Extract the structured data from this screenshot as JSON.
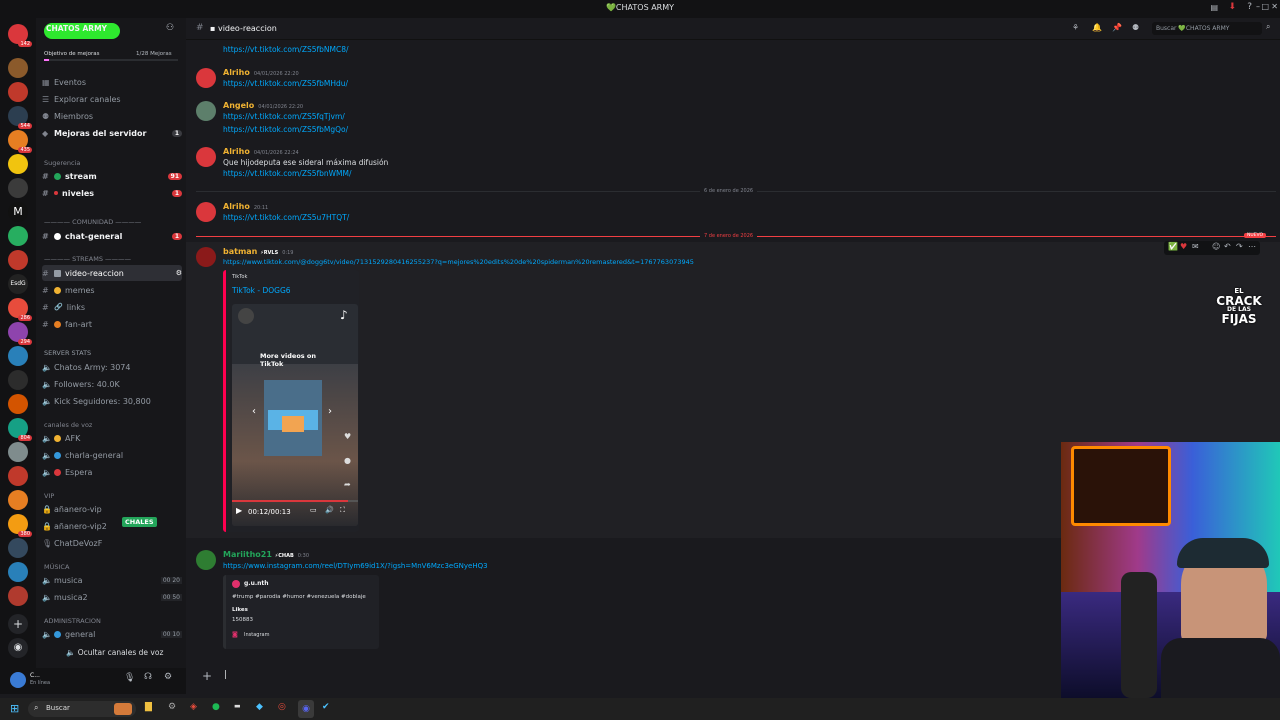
{
  "titlebar": {
    "title": "💚CHATOS ARMY"
  },
  "server": {
    "name": "CHATOS ARMY",
    "boost_label": "Objetivo de mejoras",
    "boost_count": "1/28 Mejoras"
  },
  "server_badges": [
    "142",
    "",
    "",
    "",
    "544",
    "435",
    "",
    "",
    "",
    "",
    "",
    "",
    "",
    "",
    "286",
    "",
    "294",
    "",
    "",
    "804",
    "",
    "",
    "380",
    "",
    "",
    ""
  ],
  "nav": {
    "events": "Eventos",
    "browse": "Explorar canales",
    "members": "Miembros",
    "boosts": "Mejoras del servidor",
    "boosts_badge": "1"
  },
  "channels": {
    "cat_suggestion": "Sugerencia",
    "stream": "stream",
    "stream_badge": "91",
    "niveles": "niveles",
    "niveles_badge": "1",
    "cat_comunidad": "———— COMUNIDAD ————",
    "chat_general": "chat-general",
    "chat_general_badge": "1",
    "cat_streams": "———— STREAMS ————",
    "video_reaccion": "video-reaccion",
    "memes": "memes",
    "links": "links",
    "fan_art": "fan-art",
    "cat_stats": "SERVER STATS",
    "stat_army": "Chatos Army: 3074",
    "stat_followers": "Followers: 40.0K",
    "stat_kick": "Kick Seguidores: 30,800",
    "cat_voice": "canales de voz",
    "afk": "AFK",
    "charla_general": "charla-general",
    "espera": "Espera",
    "vip": "VIP",
    "anhanero_vip": "añanero-vip",
    "anhanero_vip2": "añanero-vip2",
    "chatdevoz": "ChatDeVozF",
    "chales": "CHALES",
    "cat_musica": "MÚSICA",
    "musica": "musica",
    "musica_count": "00  20",
    "musica2": "musica2",
    "musica2_count": "00  50",
    "cat_admin": "ADMINISTRACION",
    "admin_general": "general",
    "admin_count": "00  10",
    "hide_voice": "Ocultar canales de voz"
  },
  "user": {
    "name": "C...",
    "status": "En línea"
  },
  "chat": {
    "channel": "video-reaccion",
    "search_placeholder": "Buscar 💚CHATOS ARMY",
    "messages": [
      {
        "link": "https://vt.tiktok.com/ZS5fbNMC8/"
      },
      {
        "author": "Alriho",
        "time": "04/01/2026 22:20",
        "link": "https://vt.tiktok.com/ZS5fbMHdu/"
      },
      {
        "author": "Angelo",
        "time": "04/01/2026 22:20",
        "link": "https://vt.tiktok.com/ZS5fqTjvm/",
        "link2": "https://vt.tiktok.com/ZS5fbMgQo/"
      },
      {
        "author": "Alriho",
        "time": "04/01/2026 22:24",
        "text": "Que hijodeputa ese sideral máxima difusión",
        "link": "https://vt.tiktok.com/ZS5fbnWMM/"
      },
      {
        "author": "Alriho",
        "time": "20:11",
        "link": "https://vt.tiktok.com/ZS5u7HTQT/"
      },
      {
        "author": "batman",
        "tag": "⚡RVLS",
        "time": "0:19",
        "link": "https://www.tiktok.com/@dogg6tv/video/7131529280416255237?q=mejores%20edits%20de%20spiderman%20remastered&t=1767763073945"
      },
      {
        "author": "Mariitho21",
        "tag": "⚡CHAB",
        "time": "0:30",
        "link": "https://www.instagram.com/reel/DTIym69id1X/?igsh=MnV6Mzc3eGNyeHQ3"
      }
    ],
    "date_divider": "6 de enero de 2026",
    "new_divider": "7 de enero de 2026",
    "new_badge": "NUEVO"
  },
  "tiktok_embed": {
    "provider": "TikTok",
    "title": "TikTok - DOGG6",
    "overlay": "More videos on TikTok",
    "time": "00:12/00:13"
  },
  "insta_embed": {
    "author": "g.u.nth",
    "desc": "#trump #parodia #humor #venezuela #doblaje",
    "likes_label": "Likes",
    "likes": "150883",
    "provider": "Instagram"
  },
  "overlay_logo": {
    "line1": "EL",
    "line2": "CRACK",
    "line3": "DE LAS",
    "line4": "FIJAS"
  },
  "taskbar": {
    "search": "Buscar"
  },
  "colors": {
    "accent": "#5865f2",
    "link": "#00a8fc",
    "red": "#da373c",
    "green": "#23a55a"
  }
}
